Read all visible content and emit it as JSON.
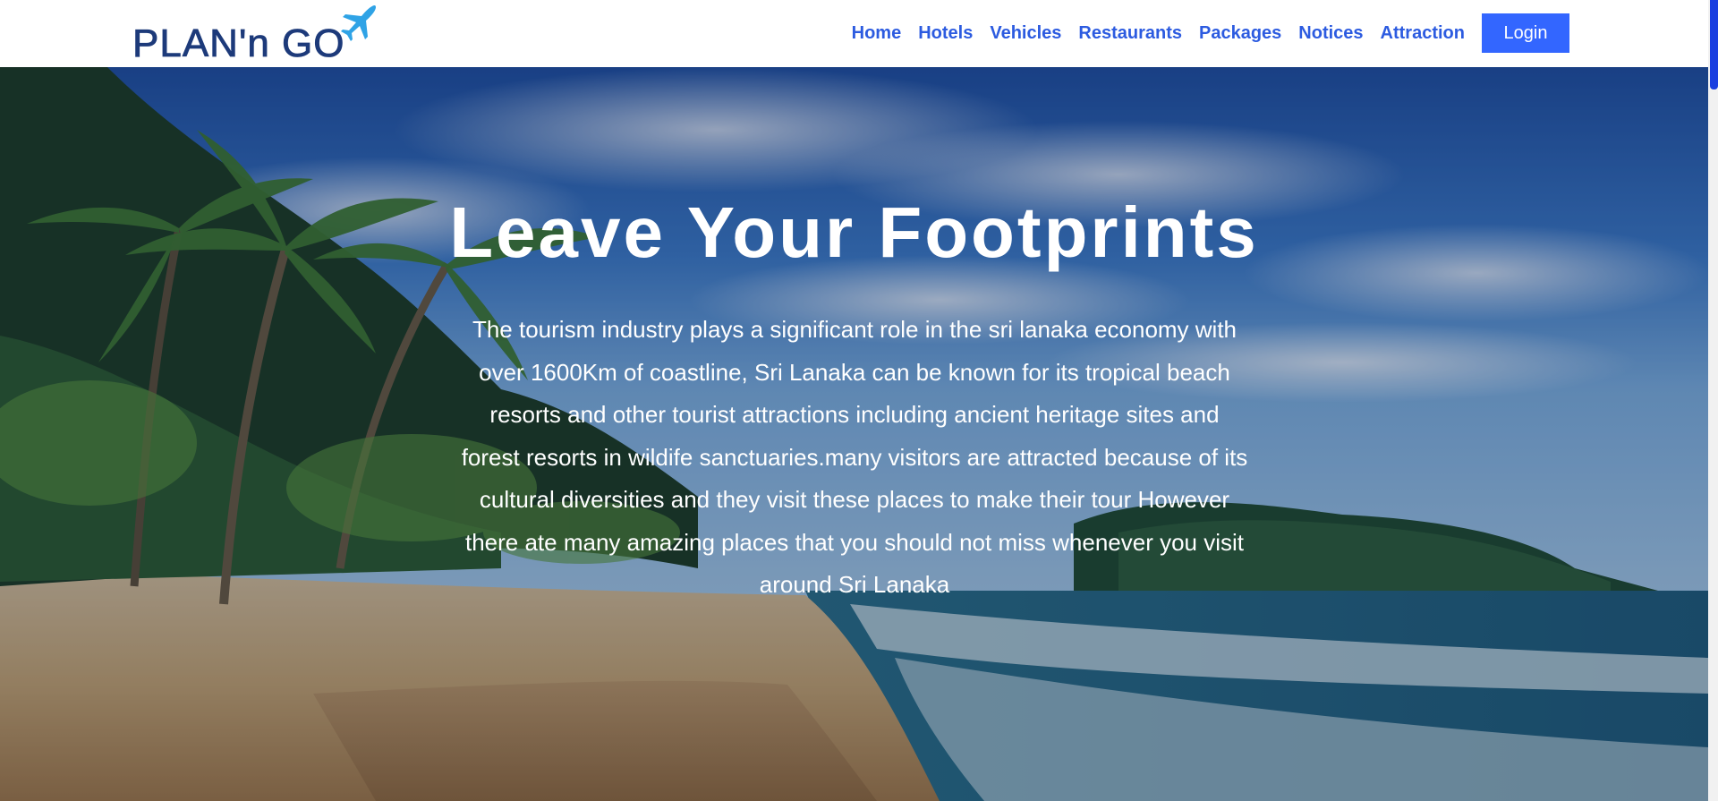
{
  "brand": {
    "name": "PLAN'n GO",
    "accent_color": "#3366ff",
    "logo_color": "#1d3a7a",
    "plane_color": "#2fa3e6"
  },
  "nav": {
    "items": [
      {
        "label": "Home"
      },
      {
        "label": "Hotels"
      },
      {
        "label": "Vehicles"
      },
      {
        "label": "Restaurants"
      },
      {
        "label": "Packages"
      },
      {
        "label": "Notices"
      },
      {
        "label": "Attraction"
      }
    ],
    "login_label": "Login"
  },
  "hero": {
    "title": "Leave Your Footprints",
    "text": "The tourism industry plays a significant role in the sri lanaka economy with over 1600Km of coastline, Sri Lanaka can be known for its tropical beach resorts and other tourist attractions including ancient heritage sites and forest resorts in wildife sanctuaries.many visitors are attracted because of its cultural diversities and they visit these places to make their tour However there ate many amazing places that you should not miss whenever you visit around Sri Lanaka",
    "background": "tropical-beach-with-palm-trees"
  },
  "scrollbar": {
    "thumb_color": "#1a3fe0"
  }
}
